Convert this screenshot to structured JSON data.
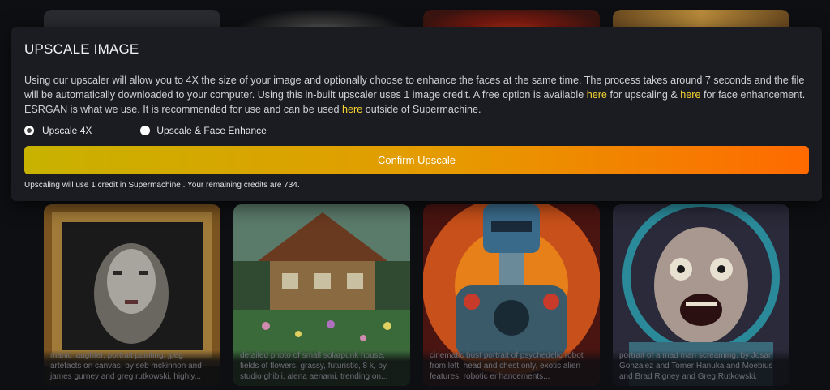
{
  "modal": {
    "title": "UPSCALE IMAGE",
    "desc_part1": "Using our upscaler will allow you to 4X the size of your image and optionally choose to enhance the faces at the same time. The process takes around 7 seconds and the file will be automatically downloaded to your computer. Using this in-built upscaler uses 1 image credit. A free option is available ",
    "link_upscaling": "here",
    "desc_part2": " for upscaling & ",
    "link_face": "here",
    "desc_part3": " for face enhancement. ESRGAN is what we use. It is recommended for use and can be used ",
    "link_esrgan": "here",
    "desc_part4": " outside of Supermachine.",
    "options": [
      {
        "label": "Upscale 4X",
        "selected": true
      },
      {
        "label": "Upscale & Face Enhance",
        "selected": false
      }
    ],
    "confirm_label": "Confirm Upscale",
    "credit_note": "Upscaling will use 1 credit in Supermachine . Your remaining credits are 734."
  },
  "gallery": {
    "captions": [
      "manic laughter, portrait painting, jpeg artefacts on canvas, by seb mckinnon and james gurney and greg rutkowski, highly...",
      "detailed photo of small solarpunk house, fields of flowers, grassy, futuristic, 8 k, by studio ghibli, alena aenami, trending on...",
      "cinematic bust portrait of psychedelic robot from left, head and chest only, exotic alien features, robotic enhancements...",
      "portrait of a mad man screaming, by Josan Gonzalez and Tomer Hanuka and Moebius and Brad Rigney and Greg Rutkowski."
    ]
  },
  "colors": {
    "accent_link": "#f7d532",
    "button_gradient_start": "#c8b200",
    "button_gradient_end": "#ff6a00"
  }
}
